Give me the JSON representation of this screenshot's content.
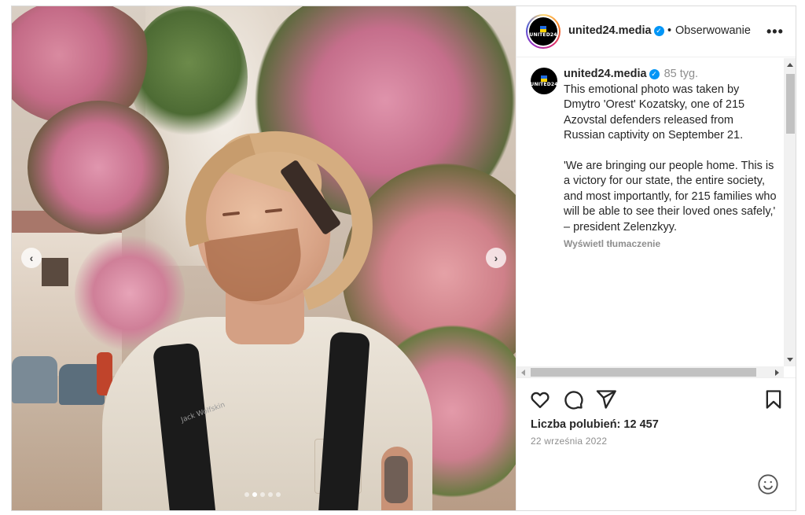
{
  "header": {
    "username": "united24.media",
    "separator": "•",
    "follow_label": "Obserwowanie",
    "more_label": "•••",
    "logo_text": "UNITED24"
  },
  "caption": {
    "username": "united24.media",
    "time_ago": "85 tyg.",
    "paragraph1": "This emotional photo was taken by Dmytro 'Orest' Kozatsky, one of 215 Azovstal defenders released from Russian captivity on September 21.",
    "paragraph2": "'We are bringing our people home. This is a victory for our state, the entire society, and most importantly, for 215 families who will be able to see their loved ones safely,' – president Zelenzkyy.",
    "translate_label": "Wyświetl tłumaczenie"
  },
  "photo": {
    "backpack_brand": "Jack Wolfskin",
    "carousel_count": 5,
    "carousel_active": 2
  },
  "actions": {
    "icons": [
      "heart-icon",
      "comment-icon",
      "share-icon",
      "bookmark-icon"
    ]
  },
  "stats": {
    "likes_label": "Liczba polubień: 12 457",
    "date": "22 września 2022"
  },
  "colors": {
    "verified": "#0095f6",
    "secondary_text": "#8e8e8e",
    "primary_text": "#262626"
  }
}
